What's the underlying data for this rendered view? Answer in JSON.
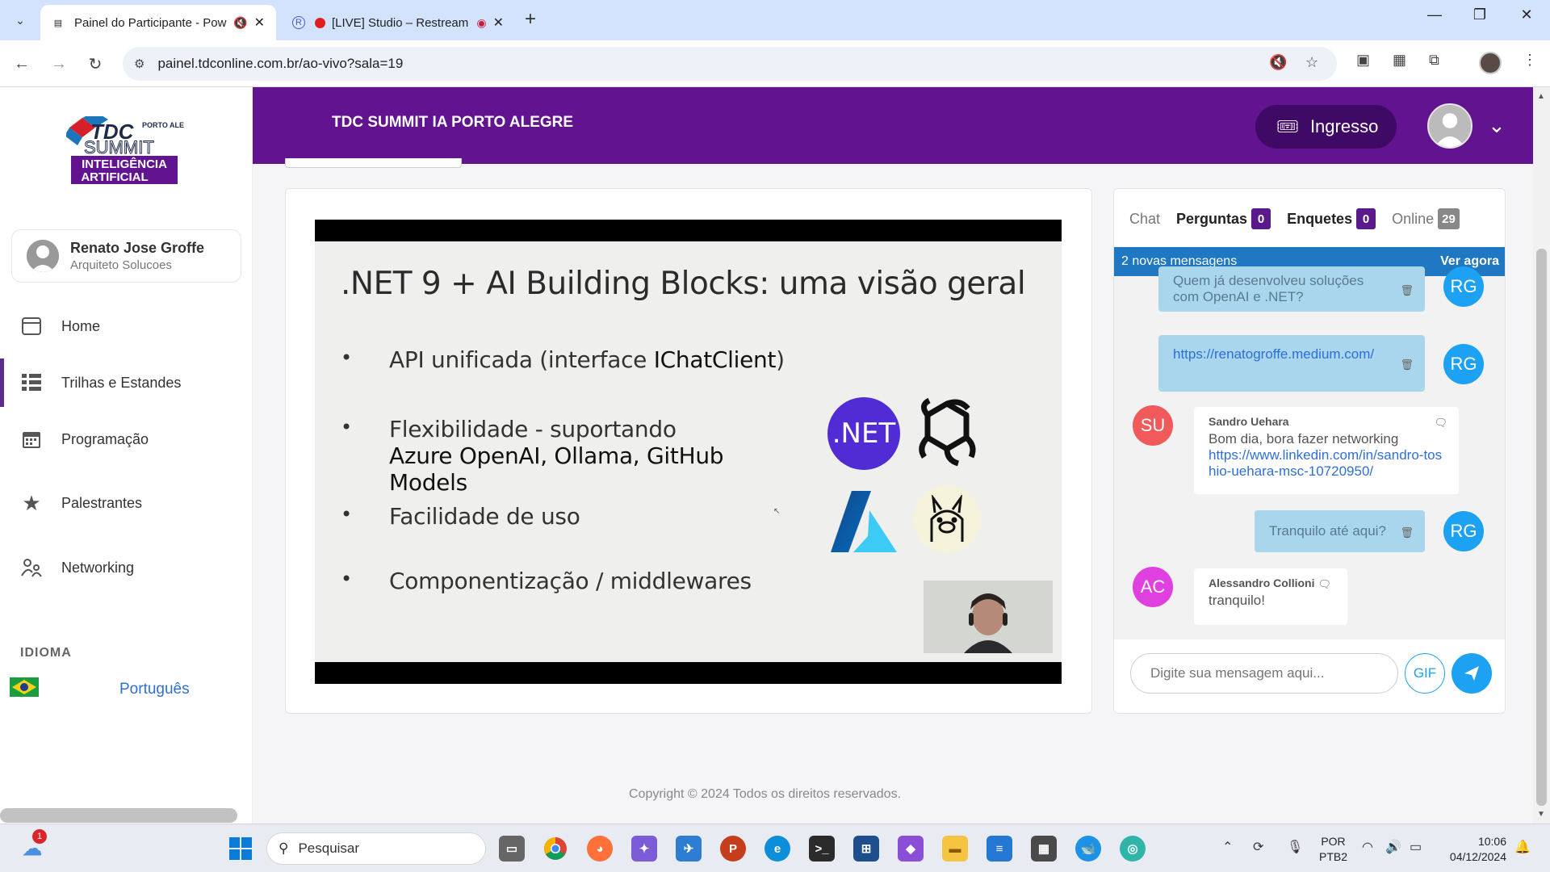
{
  "browser": {
    "tabs": [
      {
        "title": "Painel do Participante - Pow",
        "active": true
      },
      {
        "title": "[LIVE] Studio – Restream",
        "active": false
      }
    ],
    "url": "painel.tdconline.com.br/ao-vivo?sala=19",
    "window_controls": {
      "minimize": "—",
      "maximize": "❐",
      "close": "✕"
    }
  },
  "sidebar": {
    "logo": {
      "line1": "TDC",
      "line2": "PORTO ALEGRE",
      "line3": "SUMMIT",
      "line4": "INTELIGÊNCIA",
      "line5": "ARTIFICIAL"
    },
    "user": {
      "name": "Renato Jose Groffe",
      "role": "Arquiteto Solucoes"
    },
    "items": [
      {
        "label": "Home",
        "icon": "browser-window-icon"
      },
      {
        "label": "Trilhas e Estandes",
        "icon": "grid-icon"
      },
      {
        "label": "Programação",
        "icon": "calendar-icon"
      },
      {
        "label": "Palestrantes",
        "icon": "star-icon"
      },
      {
        "label": "Networking",
        "icon": "people-icon"
      }
    ],
    "idioma_label": "IDIOMA",
    "language": "Português"
  },
  "header": {
    "event_title": "TDC SUMMIT IA PORTO ALEGRE",
    "ticket_button": "Ingresso",
    "colors": {
      "bg": "#62138f",
      "button": "#3f0966"
    }
  },
  "slide": {
    "title": ".NET 9 + AI Building Blocks: uma visão geral",
    "bullets": [
      {
        "plain": "API unificada (interface ",
        "bold": "IChatClient",
        "after": ")"
      },
      {
        "plain": "Flexibilidade - suportando ",
        "bold": "Azure OpenAI, Ollama, GitHub Models",
        "after": ""
      },
      {
        "plain": "Facilidade de uso",
        "bold": "",
        "after": ""
      },
      {
        "plain": "Componentização / middlewares",
        "bold": "",
        "after": ""
      }
    ],
    "net_logo_text": ".NET"
  },
  "chat": {
    "tabs": {
      "chat": "Chat",
      "perguntas": "Perguntas",
      "perguntas_count": "0",
      "enquetes": "Enquetes",
      "enquetes_count": "0",
      "online": "Online",
      "online_count": "29"
    },
    "notice": {
      "text": "2 novas mensagens",
      "action": "Ver agora"
    },
    "messages": [
      {
        "own": true,
        "initials": "RG",
        "text": "Quem já desenvolveu soluções com OpenAI e .NET?"
      },
      {
        "own": true,
        "initials": "RG",
        "text": "https://renatogroffe.medium.com/"
      },
      {
        "own": false,
        "initials": "SU",
        "sender": "Sandro Uehara",
        "text": "Bom dia, bora fazer networking",
        "link": "https://www.linkedin.com/in/sandro-toshio-uehara-msc-10720950/"
      },
      {
        "own": true,
        "initials": "RG",
        "text": "Tranquilo até aqui?"
      },
      {
        "own": false,
        "initials": "AC",
        "sender": "Alessandro Collioni",
        "text": "tranquilo!"
      }
    ],
    "input_placeholder": "Digite sua mensagem aqui...",
    "gif_label": "GIF",
    "colors": {
      "accent": "#1da1f2",
      "notice": "#1f78c1",
      "badge": "#5b1a8c"
    }
  },
  "footer": {
    "copyright": "Copyright © 2024 Todos os direitos reservados."
  },
  "taskbar": {
    "search_placeholder": "Pesquisar",
    "weather_badge": "1",
    "lang_line1": "POR",
    "lang_line2": "PTB2",
    "time": "10:06",
    "date": "04/12/2024"
  }
}
